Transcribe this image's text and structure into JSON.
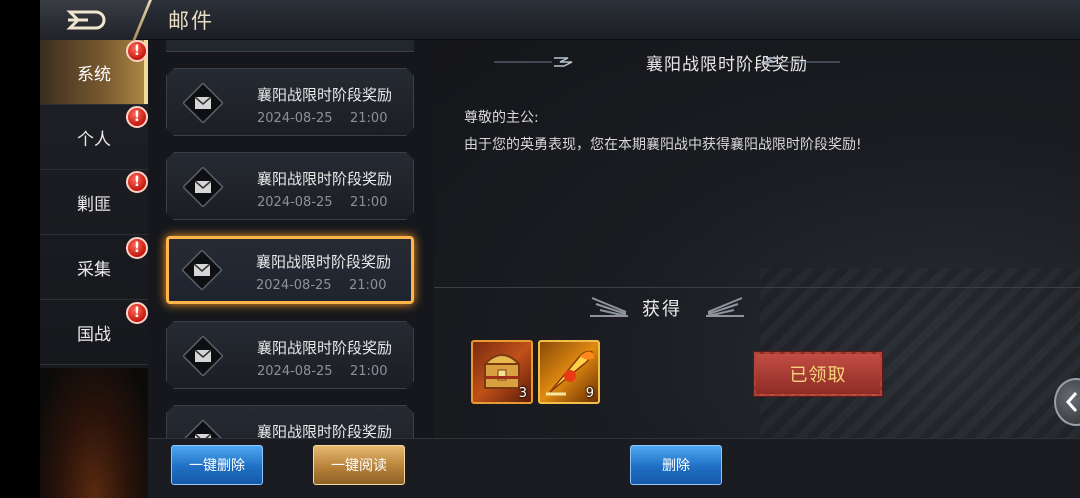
{
  "header": {
    "title": "邮件"
  },
  "tabs": [
    {
      "label": "系统",
      "active": true,
      "badge": "!"
    },
    {
      "label": "个人",
      "active": false,
      "badge": "!"
    },
    {
      "label": "剿匪",
      "active": false,
      "badge": "!"
    },
    {
      "label": "采集",
      "active": false,
      "badge": "!"
    },
    {
      "label": "国战",
      "active": false,
      "badge": "!"
    }
  ],
  "mails": [
    {
      "title": "襄阳战限时阶段奖励",
      "date": "2024-08-25",
      "time": "21:00",
      "selected": false
    },
    {
      "title": "襄阳战限时阶段奖励",
      "date": "2024-08-25",
      "time": "21:00",
      "selected": false
    },
    {
      "title": "襄阳战限时阶段奖励",
      "date": "2024-08-25",
      "time": "21:00",
      "selected": true
    },
    {
      "title": "襄阳战限时阶段奖励",
      "date": "2024-08-25",
      "time": "21:00",
      "selected": false
    },
    {
      "title": "襄阳战限时阶段奖励",
      "date": "",
      "time": "",
      "selected": false
    }
  ],
  "detail": {
    "heading": "襄阳战限时阶段奖励",
    "greeting": "尊敬的主公:",
    "body": "由于您的英勇表现，您在本期襄阳战中获得襄阳战限时阶段奖励!",
    "obtain_label": "获得",
    "rewards": [
      {
        "icon": "treasure-chest-icon",
        "count": "3"
      },
      {
        "icon": "golden-weapon-icon",
        "count": "9"
      }
    ],
    "claimed_label": "已领取"
  },
  "footer": {
    "delete_all_label": "一键删除",
    "read_all_label": "一键阅读",
    "delete_label": "删除"
  },
  "colors": {
    "accent_gold": "#b08a48",
    "selection_orange": "#ffb54a",
    "badge_red": "#c4160c",
    "button_blue": "#1f6fc4",
    "claimed_red": "#8e2c26"
  }
}
